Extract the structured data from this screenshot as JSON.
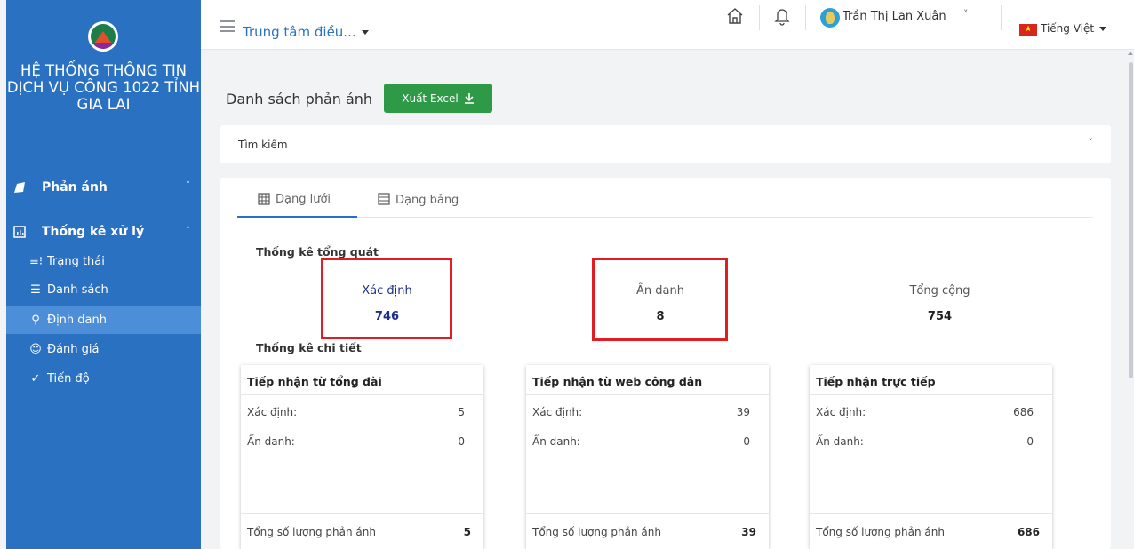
{
  "sidebar": {
    "system_title": "HỆ THỐNG THÔNG TIN DỊCH VỤ CÔNG 1022 TỈNH GIA LAI",
    "groups": [
      {
        "label": "Phản ánh",
        "chevron": "˅"
      },
      {
        "label": "Thống kê xử lý",
        "chevron": "˄"
      }
    ],
    "items": [
      {
        "label": "Trạng thái",
        "icon": "≡⁝"
      },
      {
        "label": "Danh sách",
        "icon": "☰"
      },
      {
        "label": "Định danh",
        "icon": "⚲"
      },
      {
        "label": "Đánh giá",
        "icon": "☺"
      },
      {
        "label": "Tiến độ",
        "icon": "✓"
      }
    ],
    "active_item": "Định danh",
    "bg_color": "#2a71c2",
    "active_color": "#4c8ed8"
  },
  "topbar": {
    "center_title": "Trung tâm điều...",
    "user_name": "Trần Thị Lan Xuân",
    "user_chevron": "˅",
    "language": "Tiếng Việt",
    "flag_star": "★"
  },
  "main": {
    "page_title": "Danh sách phản ánh",
    "export_button": "Xuất Excel",
    "search_label": "Tìm kiếm",
    "search_chevron": "˅",
    "tabs": [
      {
        "label": "Dạng lưới",
        "active": true
      },
      {
        "label": "Dạng bảng",
        "active": false
      }
    ],
    "summary_title": "Thống kê tổng quát",
    "summary": [
      {
        "label": "Xác định",
        "value": "746"
      },
      {
        "label": "Ẩn danh",
        "value": "8"
      },
      {
        "label": "Tổng cộng",
        "value": "754"
      }
    ],
    "detail_title": "Thống kê chi tiết",
    "cards": [
      {
        "title": "Tiếp nhận từ tổng đài",
        "identified_label": "Xác định:",
        "identified": "5",
        "anonymous_label": "Ẩn danh:",
        "anonymous": "0",
        "total_label": "Tổng số lượng phản ánh",
        "total": "5"
      },
      {
        "title": "Tiếp nhận từ web công dân",
        "identified_label": "Xác định:",
        "identified": "39",
        "anonymous_label": "Ẩn danh:",
        "anonymous": "0",
        "total_label": "Tổng số lượng phản ánh",
        "total": "39"
      },
      {
        "title": "Tiếp nhận trực tiếp",
        "identified_label": "Xác định:",
        "identified": "686",
        "anonymous_label": "Ẩn danh:",
        "anonymous": "0",
        "total_label": "Tổng số lượng phản ánh",
        "total": "686"
      }
    ],
    "export_color": "#2e9a47",
    "highlight_color": "#e11d21"
  }
}
